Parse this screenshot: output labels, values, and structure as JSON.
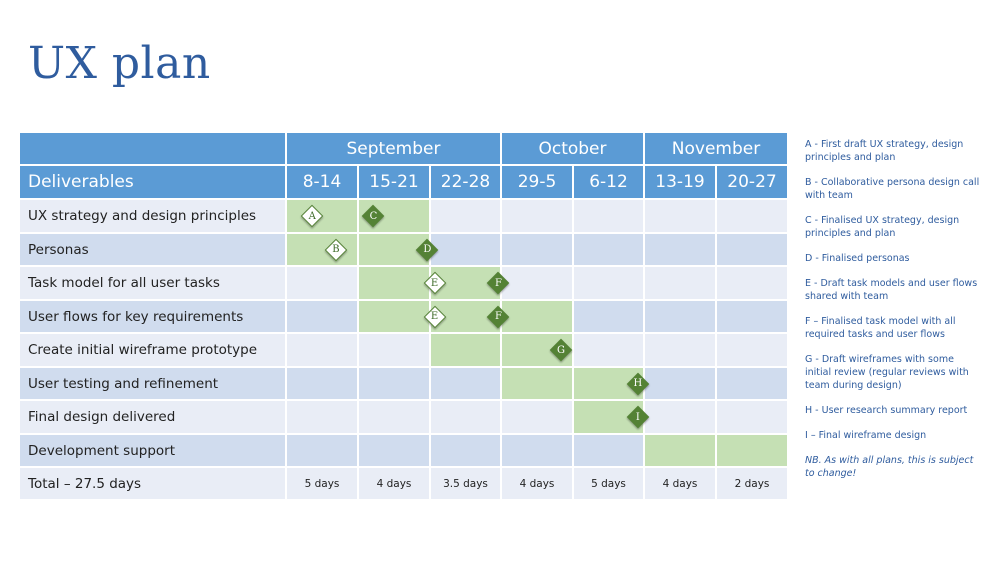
{
  "title": "UX plan",
  "header": {
    "deliverables_label": "Deliverables",
    "months": [
      {
        "label": "September",
        "span": 3
      },
      {
        "label": "October",
        "span": 2
      },
      {
        "label": "November",
        "span": 2
      }
    ],
    "weeks": [
      "8-14",
      "15-21",
      "22-28",
      "29-5",
      "6-12",
      "13-19",
      "20-27"
    ]
  },
  "colors": {
    "header_blue": "#5b9bd5",
    "row_light": "#e9edf6",
    "row_dark": "#d0dcee",
    "bar_green": "#c5e0b4",
    "milestone_green": "#548235",
    "title_blue": "#2f5c9e"
  },
  "rows": [
    {
      "label": "UX strategy and design principles",
      "active_weeks": [
        0,
        1
      ],
      "milestones": [
        {
          "letter": "A",
          "style": "white",
          "week_pos": 0.35
        },
        {
          "letter": "C",
          "style": "filled",
          "week_pos": 1.2
        }
      ]
    },
    {
      "label": "Personas",
      "active_weeks": [
        0,
        1
      ],
      "milestones": [
        {
          "letter": "B",
          "style": "white",
          "week_pos": 0.68
        },
        {
          "letter": "D",
          "style": "filled",
          "week_pos": 1.95
        }
      ]
    },
    {
      "label": "Task model for all user tasks",
      "active_weeks": [
        1,
        2
      ],
      "milestones": [
        {
          "letter": "E",
          "style": "white",
          "week_pos": 2.05
        },
        {
          "letter": "F",
          "style": "filled",
          "week_pos": 2.95
        }
      ]
    },
    {
      "label": "User flows for key requirements",
      "active_weeks": [
        1,
        2,
        3
      ],
      "milestones": [
        {
          "letter": "E",
          "style": "white",
          "week_pos": 2.05
        },
        {
          "letter": "F",
          "style": "filled",
          "week_pos": 2.95
        }
      ]
    },
    {
      "label": "Create initial wireframe prototype",
      "active_weeks": [
        2,
        3
      ],
      "milestones": [
        {
          "letter": "G",
          "style": "filled",
          "week_pos": 3.82
        }
      ]
    },
    {
      "label": "User testing and refinement",
      "active_weeks": [
        3,
        4
      ],
      "milestones": [
        {
          "letter": "H",
          "style": "filled",
          "week_pos": 4.9
        }
      ]
    },
    {
      "label": "Final design delivered",
      "active_weeks": [
        4
      ],
      "milestones": [
        {
          "letter": "I",
          "style": "filled",
          "week_pos": 4.9
        }
      ]
    },
    {
      "label": "Development support",
      "active_weeks": [
        5,
        6
      ],
      "milestones": []
    }
  ],
  "total": {
    "label": "Total – 27.5 days",
    "values": [
      "5 days",
      "4 days",
      "3.5 days",
      "4 days",
      "5 days",
      "4 days",
      "2 days"
    ]
  },
  "legend": [
    "A - First draft UX strategy, design principles and plan",
    "B - Collaborative persona design call with team",
    "C - Finalised UX strategy, design principles and plan",
    "D - Finalised personas",
    "E - Draft task models and user flows shared with team",
    "F – Finalised task model with all required tasks and user flows",
    "G - Draft wireframes with some initial review (regular reviews with team during design)",
    "H - User research summary report",
    "I – Final wireframe design"
  ],
  "note": "NB. As with all plans, this is subject to change!"
}
